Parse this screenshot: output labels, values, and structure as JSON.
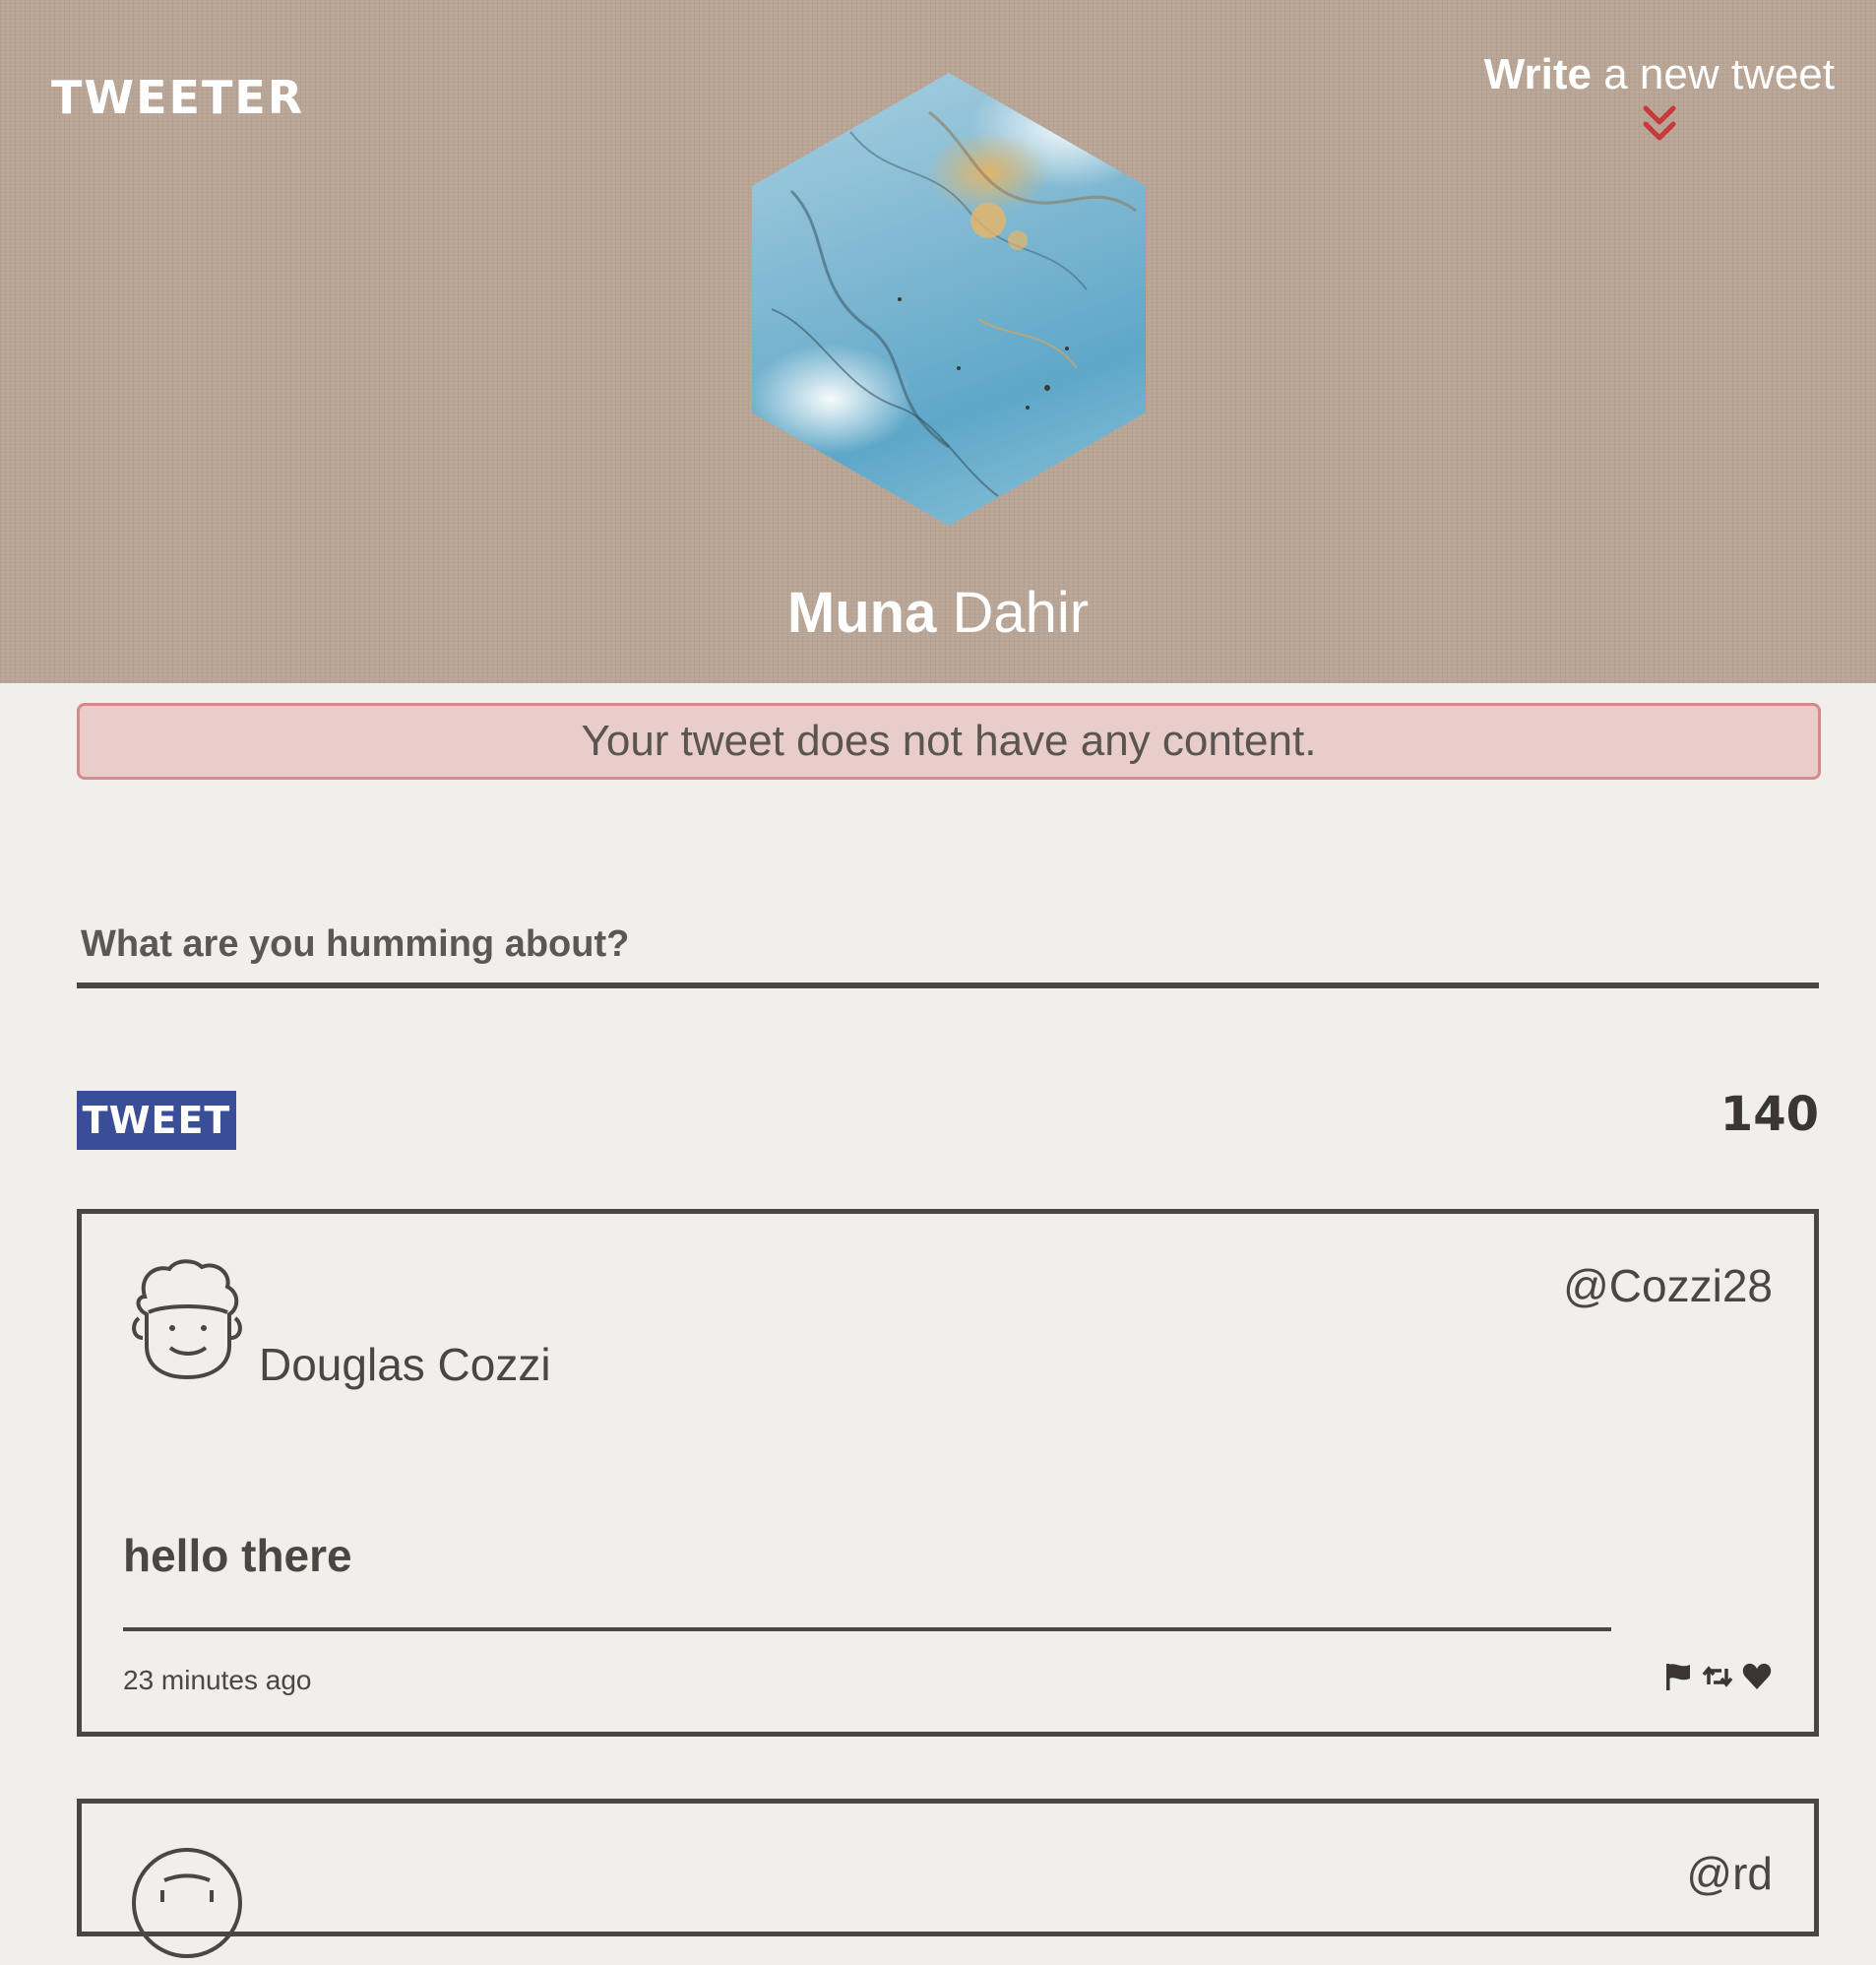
{
  "header": {
    "logo": "TWEETER",
    "compose_toggle": {
      "bold": "Write",
      "rest": " a new tweet",
      "icon": "chevrons-down-icon",
      "icon_color": "#c8393a"
    },
    "profile": {
      "first_name": "Muna",
      "last_name": "Dahir"
    },
    "background_color": "#b8a596"
  },
  "error": {
    "message": "Your tweet does not have any content."
  },
  "compose": {
    "placeholder": "What are you humming about?",
    "value": "",
    "button_label": "TWEET",
    "button_color": "#3a4e98",
    "counter": "140"
  },
  "tweets": [
    {
      "name": "Douglas Cozzi",
      "handle": "@Cozzi28",
      "content": "hello there",
      "time": "23 minutes ago",
      "actions": [
        "flag-icon",
        "retweet-icon",
        "heart-icon"
      ]
    },
    {
      "name": "",
      "handle": "@rd",
      "content": "",
      "time": ""
    }
  ]
}
